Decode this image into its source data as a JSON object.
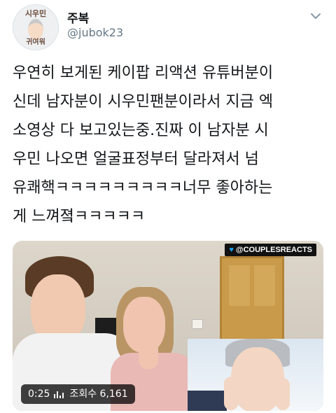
{
  "profile": {
    "display_name": "주복",
    "handle": "@jubok23",
    "avatar_top_text": "시우민",
    "avatar_bottom_text": "귀여워"
  },
  "tweet": {
    "lines": [
      "우연히 보게된 케이팝 리액션 유튜버분이",
      "신데 남자분이 시우민팬분이라서 지금 엑",
      "소영상 다 보고있는중.진짜 이 남자분 시",
      "우민 나오면 얼굴표정부터 달라져서 넘",
      "유쾌핵ㅋㅋㅋㅋㅋㅋㅋㅋㅋ너무 좋아하는",
      "게 느껴졐ㅋㅋㅋㅋㅋ"
    ]
  },
  "video": {
    "watermark": "@COUPLESREACTS",
    "time": "0:25",
    "views": "조회수 6,161"
  },
  "icons": {
    "caret": "chevron-down-icon",
    "bird": "twitter-bird-icon",
    "bars": "audio-bars-icon"
  },
  "colors": {
    "text": "#14171a",
    "secondary": "#657786",
    "twitter_blue": "#1da1f2"
  }
}
